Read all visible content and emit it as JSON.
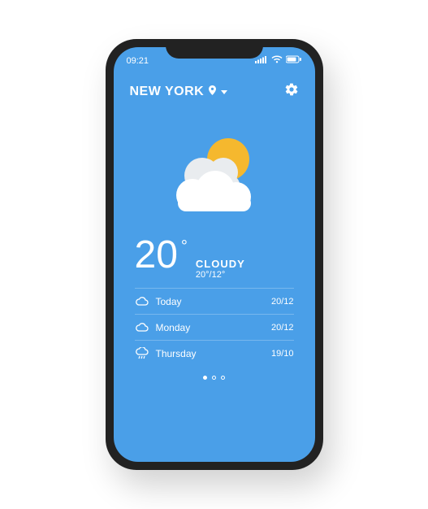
{
  "status": {
    "time": "09:21"
  },
  "header": {
    "location": "NEW YORK"
  },
  "current": {
    "temp": "20",
    "degree": "°",
    "condition": "CLOUDY",
    "high": "20°",
    "low": "/12°"
  },
  "forecast": [
    {
      "day": "Today",
      "icon": "cloud",
      "high": "20",
      "low": "/12"
    },
    {
      "day": "Monday",
      "icon": "cloud",
      "high": "20",
      "low": "/12"
    },
    {
      "day": "Thursday",
      "icon": "cloud-rain",
      "high": "19",
      "low": "/10"
    }
  ],
  "pager": {
    "count": 3,
    "active": 0
  }
}
